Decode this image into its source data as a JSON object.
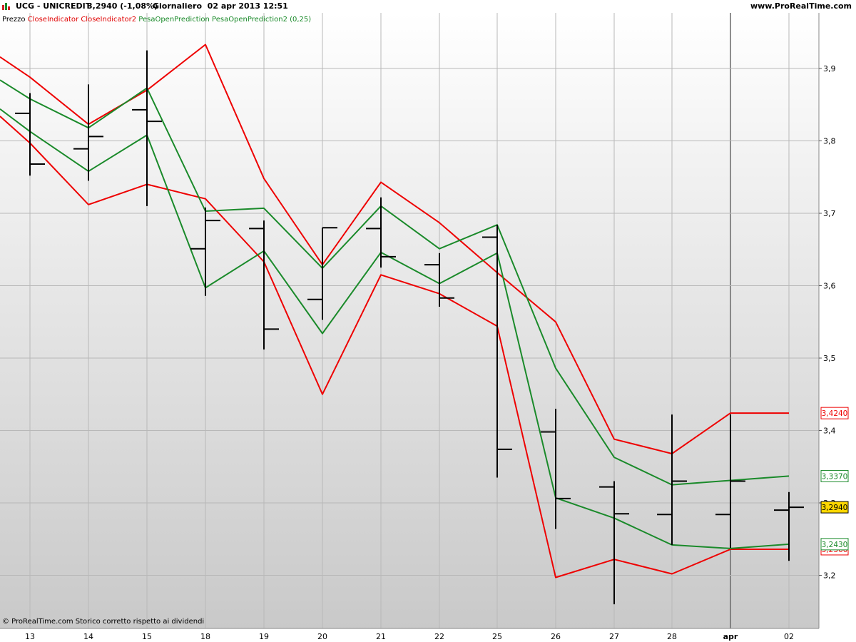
{
  "header": {
    "title": "UCG - UNICREDIT",
    "price": "3,2940 (-1,08%)",
    "period": "Giornaliero  02 apr 2013 12:51",
    "site": "www.ProRealTime.com"
  },
  "legend": {
    "price_label": "Prezzo",
    "close_indicator": "CloseIndicator CloseIndicator2",
    "pesa_open": "PesaOpenPrediction PesaOpenPrediction2 (0,25)"
  },
  "footer": {
    "copyright": "© ProRealTime.com  Storico corretto rispetto ai dividendi"
  },
  "colors": {
    "price": "#000000",
    "close_indicator": "#ee0000",
    "pesa_open": "#1a8a2a",
    "last_price_tag": "#ffd700"
  },
  "chart_data": {
    "type": "line",
    "x_tick_labels": [
      "13",
      "14",
      "15",
      "18",
      "19",
      "20",
      "21",
      "22",
      "25",
      "26",
      "27",
      "28",
      "apr",
      "02"
    ],
    "y_tick_labels": [
      "3,2",
      "3,3",
      "3,4",
      "3,5",
      "3,6",
      "3,7",
      "3,8",
      "3,9"
    ],
    "ylim": [
      3.12,
      3.99
    ],
    "grid": true,
    "price_bars": [
      {
        "open": 3.838,
        "high": 3.866,
        "low": 3.752,
        "close": 3.768
      },
      {
        "open": 3.789,
        "high": 3.878,
        "low": 3.745,
        "close": 3.806
      },
      {
        "open": 3.843,
        "high": 3.925,
        "low": 3.71,
        "close": 3.827
      },
      {
        "open": 3.651,
        "high": 3.708,
        "low": 3.586,
        "close": 3.69
      },
      {
        "open": 3.679,
        "high": 3.69,
        "low": 3.512,
        "close": 3.54
      },
      {
        "open": 3.581,
        "high": 3.68,
        "low": 3.553,
        "close": 3.68
      },
      {
        "open": 3.679,
        "high": 3.722,
        "low": 3.625,
        "close": 3.64
      },
      {
        "open": 3.629,
        "high": 3.645,
        "low": 3.571,
        "close": 3.583
      },
      {
        "open": 3.667,
        "high": 3.684,
        "low": 3.335,
        "close": 3.374
      },
      {
        "open": 3.398,
        "high": 3.43,
        "low": 3.264,
        "close": 3.306
      },
      {
        "open": 3.322,
        "high": 3.33,
        "low": 3.16,
        "close": 3.285
      },
      {
        "open": 3.284,
        "high": 3.422,
        "low": 3.242,
        "close": 3.33
      },
      {
        "open": 3.284,
        "high": 3.422,
        "low": 3.238,
        "close": 3.33
      },
      {
        "open": 3.29,
        "high": 3.315,
        "low": 3.22,
        "close": 3.294
      }
    ],
    "series": [
      {
        "name": "CloseIndicator",
        "color": "#ee0000",
        "values": [
          3.888,
          3.823,
          3.87,
          3.933,
          3.748,
          3.629,
          3.743,
          3.687,
          3.618,
          3.55,
          3.388,
          3.368,
          3.424,
          3.424
        ]
      },
      {
        "name": "CloseIndicator2",
        "color": "#ee0000",
        "values": [
          3.797,
          3.712,
          3.74,
          3.72,
          3.633,
          3.45,
          3.615,
          3.589,
          3.544,
          3.197,
          3.222,
          3.202,
          3.236,
          3.236
        ]
      },
      {
        "name": "PesaOpenPrediction",
        "color": "#1a8a2a",
        "values": [
          3.858,
          3.818,
          3.873,
          3.703,
          3.707,
          3.624,
          3.71,
          3.651,
          3.684,
          3.486,
          3.363,
          3.325,
          3.331,
          3.337
        ]
      },
      {
        "name": "PesaOpenPrediction2",
        "color": "#1a8a2a",
        "values": [
          3.813,
          3.758,
          3.808,
          3.597,
          3.648,
          3.534,
          3.646,
          3.603,
          3.645,
          3.307,
          3.279,
          3.242,
          3.237,
          3.243
        ]
      }
    ],
    "left_edge": {
      "close_indicator": 3.916,
      "close_indicator2": 3.834,
      "pesa_open": 3.884,
      "pesa_open2": 3.844
    },
    "value_tags": [
      {
        "text": "3,4240",
        "value": 3.424,
        "color": "#ee0000"
      },
      {
        "text": "3,3370",
        "value": 3.337,
        "color": "#1a8a2a"
      },
      {
        "text": "3,2940",
        "value": 3.294,
        "color": "#000000",
        "highlight": true
      },
      {
        "text": "3,2360",
        "value": 3.236,
        "color": "#ee0000"
      },
      {
        "text": "3,2430",
        "value": 3.243,
        "color": "#1a8a2a"
      }
    ],
    "month_separator": "apr"
  }
}
